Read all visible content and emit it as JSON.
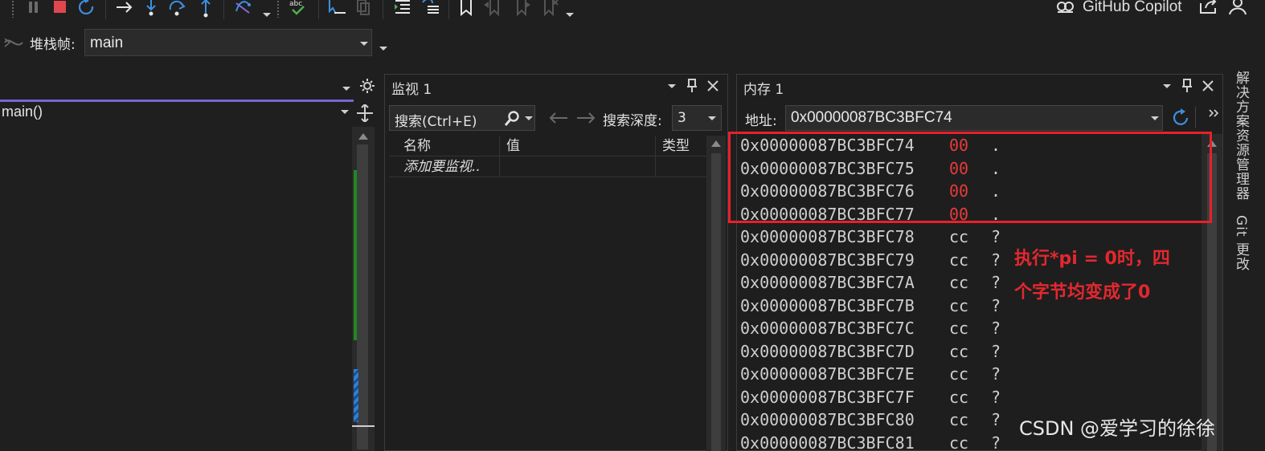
{
  "toolbar": {
    "icons": [
      "pause-icon",
      "stop-icon",
      "restart-icon",
      "show-next-statement-icon",
      "step-into-icon",
      "step-over-icon",
      "step-out-icon",
      "hot-reload-icon",
      "spell-check-icon",
      "cursor-select-icon",
      "copy-icon",
      "indent-icon",
      "format-icon",
      "bookmark-icon",
      "prev-bookmark-icon",
      "next-bookmark-icon",
      "clear-bookmark-icon"
    ],
    "copilot_label": "GitHub Copilot"
  },
  "stack_frame": {
    "label": "堆栈帧:",
    "value": "main"
  },
  "left_pane": {
    "function_combo": "main()"
  },
  "watch": {
    "title": "监视 1",
    "search_placeholder": "搜索(Ctrl+E)",
    "depth_label": "搜索深度:",
    "depth_value": "3",
    "columns": [
      "名称",
      "值",
      "类型"
    ],
    "rows": [
      {
        "name": "添加要监视..",
        "value": "",
        "type": ""
      }
    ]
  },
  "memory": {
    "title": "内存 1",
    "address_label": "地址:",
    "address_value": "0x00000087BC3BFC74",
    "rows": [
      {
        "addr": "0x00000087BC3BFC74",
        "byte": "00",
        "char": ".",
        "changed": true
      },
      {
        "addr": "0x00000087BC3BFC75",
        "byte": "00",
        "char": ".",
        "changed": true
      },
      {
        "addr": "0x00000087BC3BFC76",
        "byte": "00",
        "char": ".",
        "changed": true
      },
      {
        "addr": "0x00000087BC3BFC77",
        "byte": "00",
        "char": ".",
        "changed": true
      },
      {
        "addr": "0x00000087BC3BFC78",
        "byte": "cc",
        "char": "?",
        "changed": false
      },
      {
        "addr": "0x00000087BC3BFC79",
        "byte": "cc",
        "char": "?",
        "changed": false
      },
      {
        "addr": "0x00000087BC3BFC7A",
        "byte": "cc",
        "char": "?",
        "changed": false
      },
      {
        "addr": "0x00000087BC3BFC7B",
        "byte": "cc",
        "char": "?",
        "changed": false
      },
      {
        "addr": "0x00000087BC3BFC7C",
        "byte": "cc",
        "char": "?",
        "changed": false
      },
      {
        "addr": "0x00000087BC3BFC7D",
        "byte": "cc",
        "char": "?",
        "changed": false
      },
      {
        "addr": "0x00000087BC3BFC7E",
        "byte": "cc",
        "char": "?",
        "changed": false
      },
      {
        "addr": "0x00000087BC3BFC7F",
        "byte": "cc",
        "char": "?",
        "changed": false
      },
      {
        "addr": "0x00000087BC3BFC80",
        "byte": "cc",
        "char": "?",
        "changed": false
      },
      {
        "addr": "0x00000087BC3BFC81",
        "byte": "cc",
        "char": "?",
        "changed": false
      }
    ]
  },
  "annotation": {
    "line1": "执行*pi = 0时，四",
    "line2": "个字节均变成了0"
  },
  "side_tabs": {
    "solution_explorer": "解决方案资源管理器",
    "git_changes": "Git 更改"
  },
  "watermark": "CSDN @爱学习的徐徐",
  "colors": {
    "changed_byte": "#e83a3a",
    "annotation": "#e3282f",
    "accent_tab": "#7b63d6",
    "coverage_green": "#1e8a1e",
    "highlight_blue": "#2f7fd8"
  }
}
